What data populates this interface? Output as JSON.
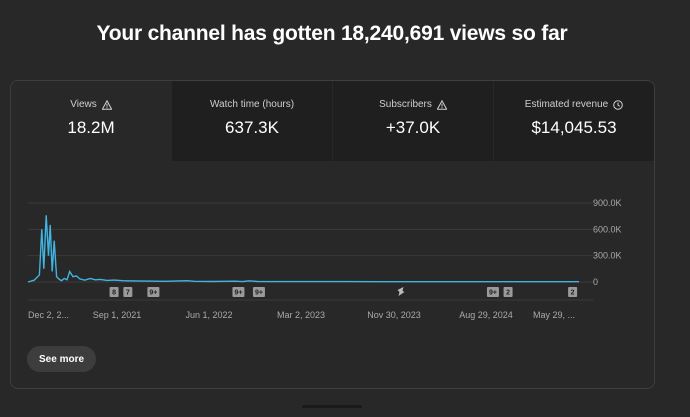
{
  "headline": "Your channel has gotten 18,240,691 views so far",
  "tabs": [
    {
      "label": "Views",
      "value": "18.2M",
      "icon": "warning-icon"
    },
    {
      "label": "Watch time (hours)",
      "value": "637.3K",
      "icon": ""
    },
    {
      "label": "Subscribers",
      "value": "+37.0K",
      "icon": "warning-icon"
    },
    {
      "label": "Estimated revenue",
      "value": "$14,045.53",
      "icon": "clock-icon"
    }
  ],
  "chart_data": {
    "type": "line",
    "y_ticks": [
      "900.0K",
      "600.0K",
      "300.0K",
      "0"
    ],
    "y_values": [
      900000,
      600000,
      300000,
      0
    ],
    "ylim": [
      0,
      900000
    ],
    "x_ticks": [
      "Dec 2, 2...",
      "Sep 1, 2021",
      "Jun 1, 2022",
      "Mar 2, 2023",
      "Nov 30, 2023",
      "Aug 29, 2024",
      "May 29, ..."
    ],
    "xlim": [
      "2020-12-02",
      "2025-05-29"
    ],
    "series": [
      {
        "color": "#41b4e1",
        "x": [
          "2020-12-02",
          "2020-12-20",
          "2021-01-05",
          "2021-01-12",
          "2021-01-18",
          "2021-01-25",
          "2021-02-01",
          "2021-02-06",
          "2021-02-12",
          "2021-02-18",
          "2021-02-25",
          "2021-03-05",
          "2021-03-12",
          "2021-03-20",
          "2021-03-28",
          "2021-04-05",
          "2021-04-15",
          "2021-04-25",
          "2021-05-05",
          "2021-05-20",
          "2021-06-05",
          "2021-06-20",
          "2021-07-05",
          "2021-07-25",
          "2021-08-15",
          "2021-09-10",
          "2021-10-15",
          "2021-11-20",
          "2022-01-15",
          "2022-03-20",
          "2022-04-10",
          "2022-06-01",
          "2022-08-10",
          "2022-09-01",
          "2022-09-20",
          "2022-10-15",
          "2022-12-01",
          "2023-03-02",
          "2023-07-01",
          "2023-11-30",
          "2024-05-01",
          "2024-08-29",
          "2025-01-01",
          "2025-05-29"
        ],
        "y": [
          0,
          20000,
          80000,
          600000,
          150000,
          760000,
          300000,
          650000,
          120000,
          470000,
          60000,
          30000,
          15000,
          40000,
          25000,
          120000,
          60000,
          70000,
          35000,
          20000,
          40000,
          25000,
          30000,
          18000,
          22000,
          15000,
          12000,
          10000,
          8000,
          15000,
          8000,
          6000,
          9000,
          5000,
          14000,
          6000,
          5000,
          4000,
          4000,
          3000,
          3000,
          3000,
          3000,
          3000
        ]
      }
    ],
    "event_markers": [
      {
        "label": "8",
        "date": "2021-08-15"
      },
      {
        "label": "7",
        "date": "2021-09-25"
      },
      {
        "label": "9+",
        "date": "2021-12-10"
      },
      {
        "label": "9+",
        "date": "2022-08-20"
      },
      {
        "label": "9+",
        "date": "2022-10-20"
      },
      {
        "label": "shorts-icon",
        "date": "2023-12-15"
      },
      {
        "label": "9+",
        "date": "2024-09-15"
      },
      {
        "label": "2",
        "date": "2024-10-30"
      },
      {
        "label": "2",
        "date": "2025-05-10"
      }
    ]
  },
  "see_more_label": "See more",
  "colors": {
    "background": "#282828",
    "tab_inactive": "#1f1f1f",
    "line": "#41b4e1",
    "marker": "#9a9a9a"
  }
}
